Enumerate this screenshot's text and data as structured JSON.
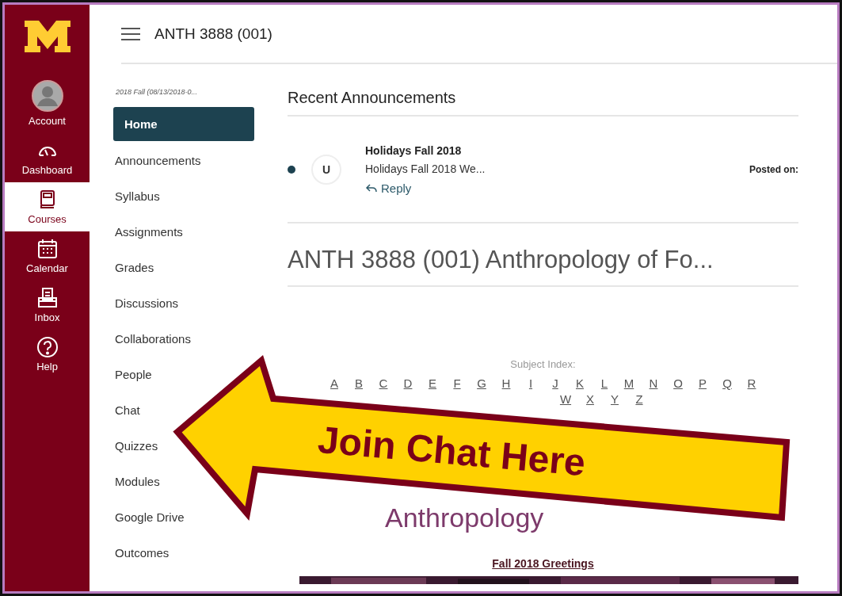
{
  "global_nav": {
    "items": [
      {
        "kind": "account",
        "label": "Account",
        "selected": false
      },
      {
        "kind": "dashboard",
        "label": "Dashboard",
        "selected": false
      },
      {
        "kind": "courses",
        "label": "Courses",
        "selected": true
      },
      {
        "kind": "calendar",
        "label": "Calendar",
        "selected": false
      },
      {
        "kind": "inbox",
        "label": "Inbox",
        "selected": false
      },
      {
        "kind": "help",
        "label": "Help",
        "selected": false
      }
    ]
  },
  "header": {
    "title": "ANTH 3888 (001)"
  },
  "course_nav": {
    "term": "2018 Fall (08/13/2018-0...",
    "items": [
      {
        "label": "Home",
        "selected": true
      },
      {
        "label": "Announcements",
        "selected": false
      },
      {
        "label": "Syllabus",
        "selected": false
      },
      {
        "label": "Assignments",
        "selected": false
      },
      {
        "label": "Grades",
        "selected": false
      },
      {
        "label": "Discussions",
        "selected": false
      },
      {
        "label": "Collaborations",
        "selected": false
      },
      {
        "label": "People",
        "selected": false
      },
      {
        "label": "Chat",
        "selected": false
      },
      {
        "label": "Quizzes",
        "selected": false
      },
      {
        "label": "Modules",
        "selected": false
      },
      {
        "label": "Google Drive",
        "selected": false
      },
      {
        "label": "Outcomes",
        "selected": false
      }
    ]
  },
  "announcements": {
    "heading": "Recent Announcements",
    "items": [
      {
        "unread": true,
        "avatar": "U",
        "title": "Holidays Fall 2018",
        "excerpt": "Holidays Fall 2018 We...",
        "reply": "Reply",
        "posted": "Posted on:"
      }
    ]
  },
  "page": {
    "title": "ANTH 3888 (001) Anthropology of Fo...",
    "subject_index_label": "Subject Index:",
    "letters_row_1": [
      "A",
      "B",
      "C",
      "D",
      "E",
      "F",
      "G",
      "H",
      "I",
      "J",
      "K",
      "L",
      "M",
      "N",
      "O",
      "P",
      "Q",
      "R"
    ],
    "letters_row_2": [
      "W",
      "X",
      "Y",
      "Z"
    ],
    "course_title": "Anthropology",
    "link": "Fall 2018 Greetings"
  },
  "callout": {
    "text": "Join Chat Here"
  }
}
